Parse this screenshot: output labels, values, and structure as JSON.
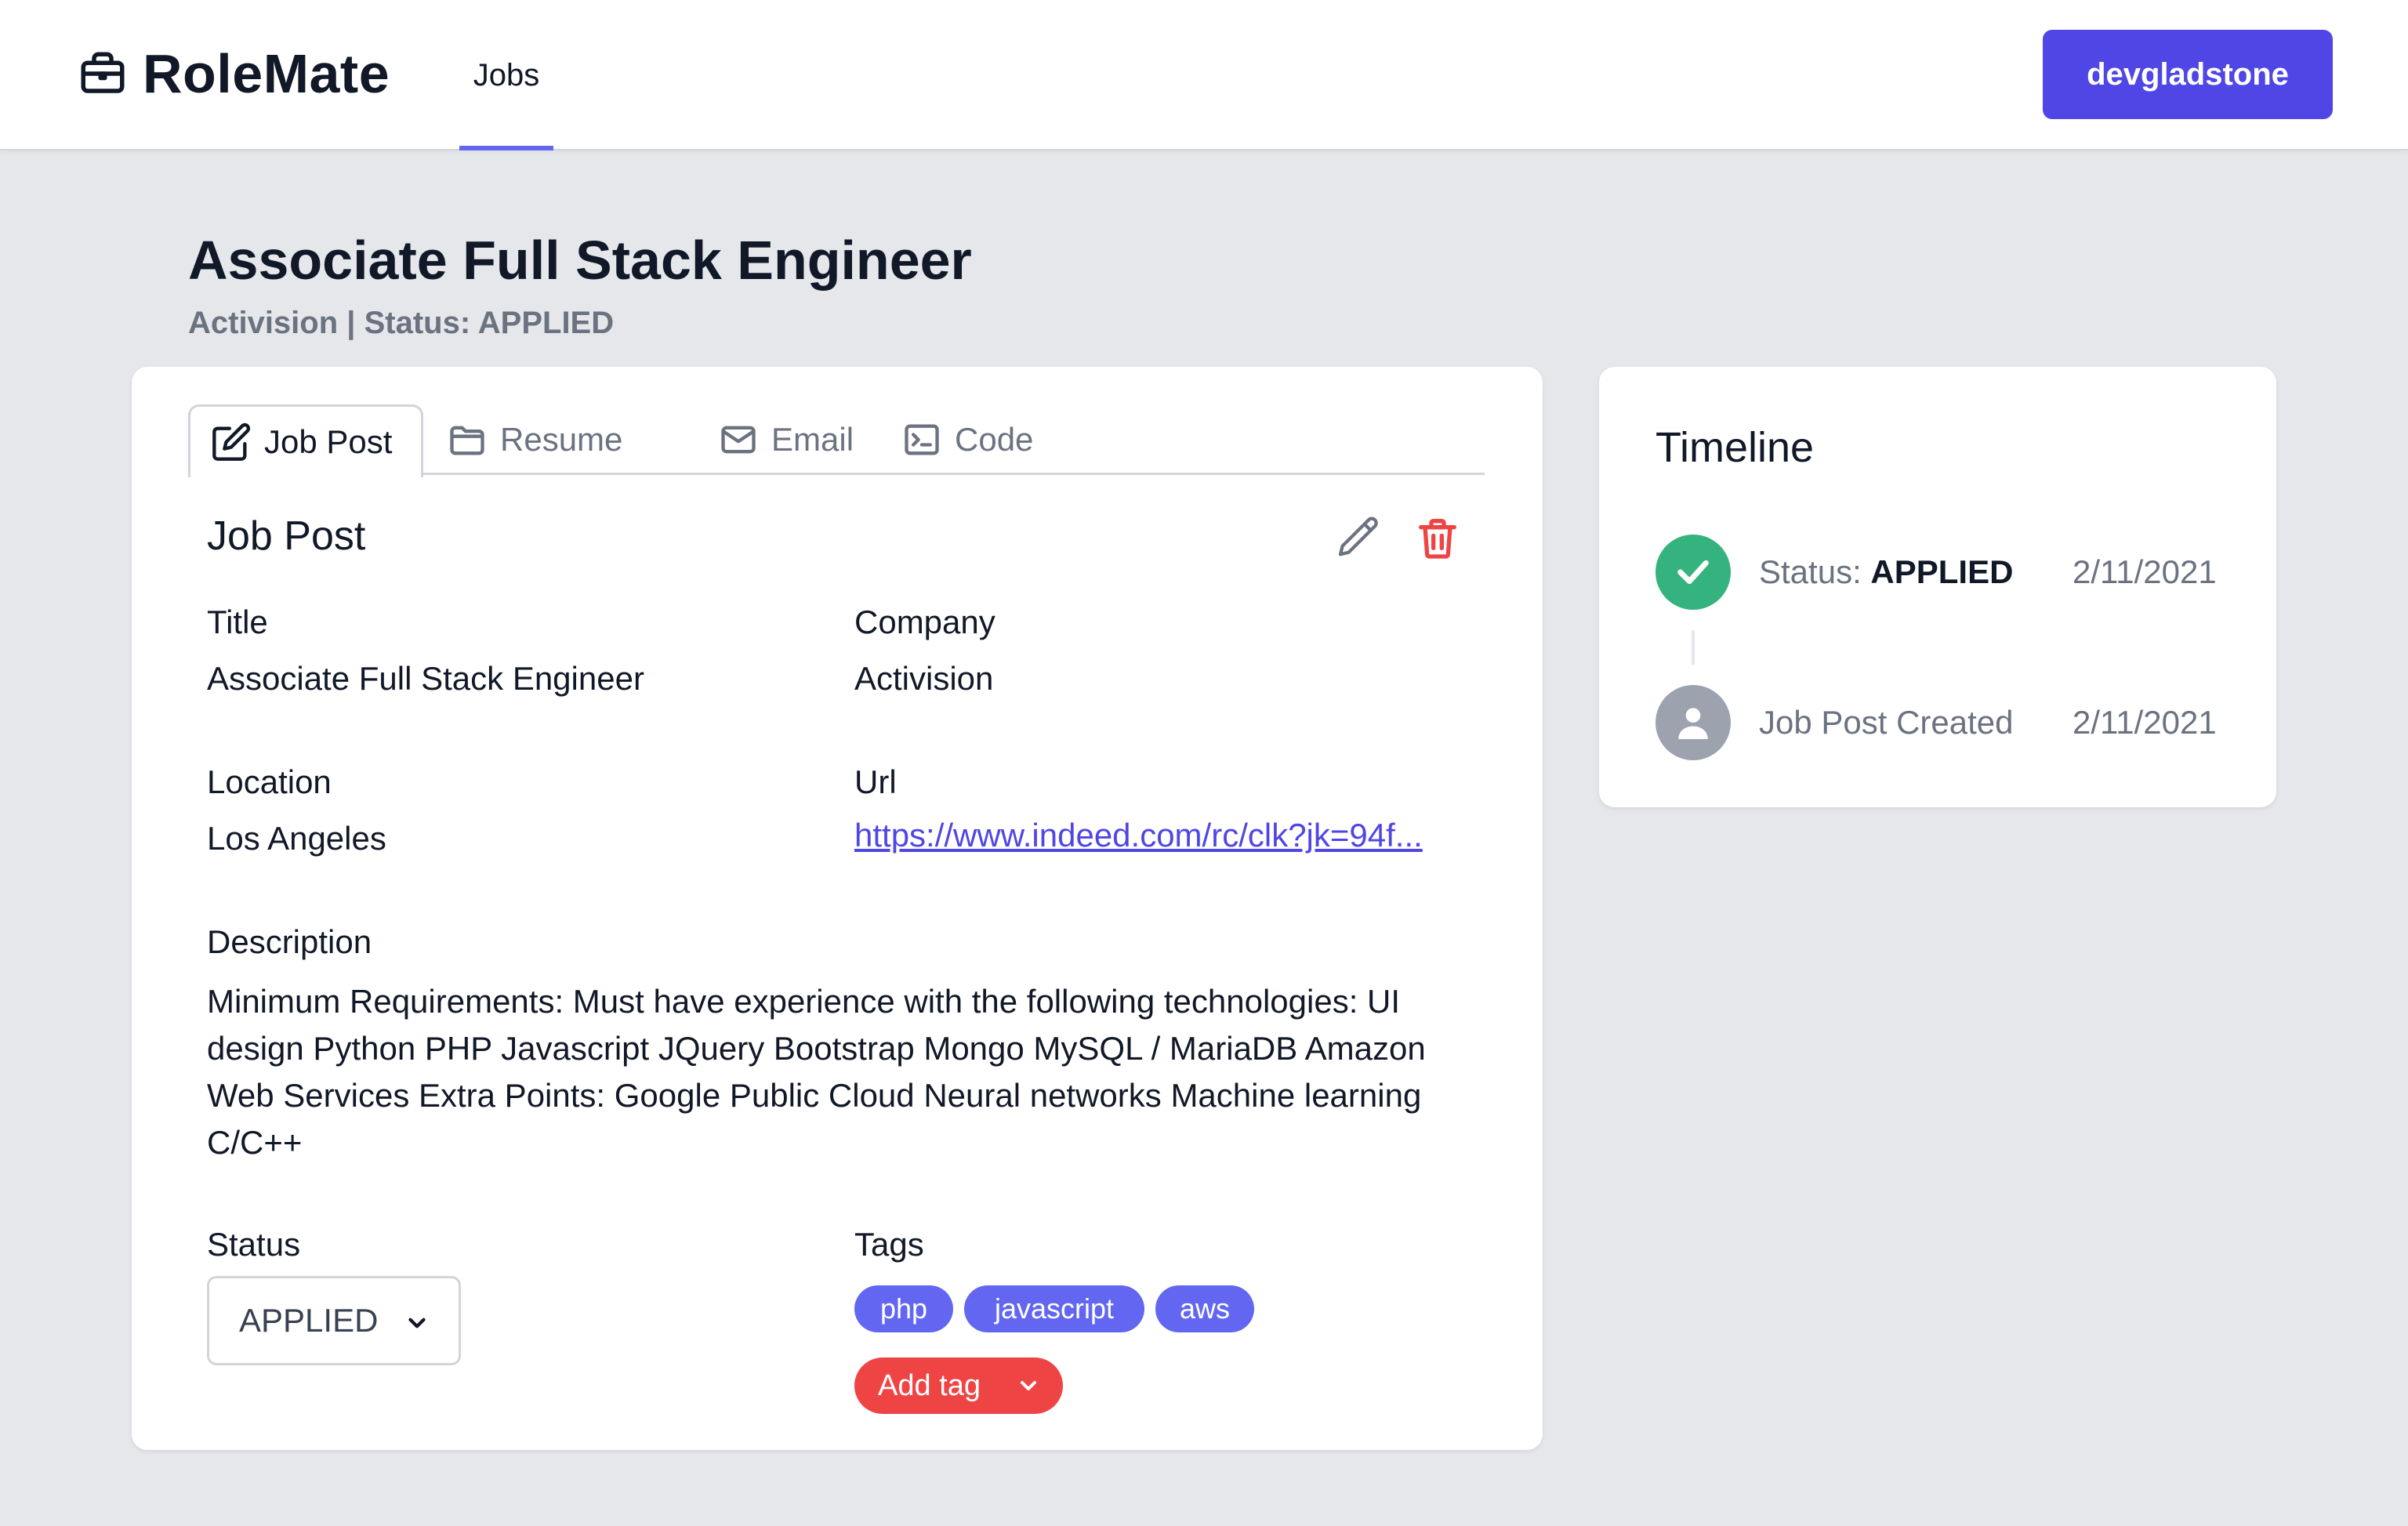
{
  "header": {
    "brand": "RoleMate",
    "nav": {
      "jobs": "Jobs"
    },
    "user_button": "devgladstone"
  },
  "page": {
    "title": "Associate Full Stack Engineer",
    "subtitle": "Activision | Status: APPLIED"
  },
  "tabs": {
    "job_post": "Job Post",
    "resume": "Resume",
    "email": "Email",
    "code": "Code"
  },
  "job_post": {
    "section_title": "Job Post",
    "title_label": "Title",
    "title_value": "Associate Full Stack Engineer",
    "company_label": "Company",
    "company_value": "Activision",
    "location_label": "Location",
    "location_value": "Los Angeles",
    "url_label": "Url",
    "url_value": "https://www.indeed.com/rc/clk?jk=94f...",
    "description_label": "Description",
    "description_value": "Minimum Requirements: Must have experience with the following technologies: UI design Python PHP Javascript JQuery Bootstrap Mongo MySQL / MariaDB Amazon Web Services Extra Points: Google Public Cloud Neural networks Machine learning C/C++",
    "status_label": "Status",
    "status_value": "APPLIED",
    "tags_label": "Tags",
    "tags": [
      "php",
      "javascript",
      "aws"
    ],
    "add_tag": "Add tag"
  },
  "timeline": {
    "title": "Timeline",
    "events": [
      {
        "prefix": "Status: ",
        "value": "APPLIED",
        "date": "2/11/2021",
        "icon": "check-icon"
      },
      {
        "prefix": "Job Post Created",
        "value": "",
        "date": "2/11/2021",
        "icon": "user-icon"
      }
    ]
  },
  "colors": {
    "primary": "#4f46e5",
    "tag": "#6366f1",
    "danger": "#ef4444",
    "success": "#34b37e",
    "muted_icon": "#9ca3af",
    "background": "#e5e7eb"
  }
}
